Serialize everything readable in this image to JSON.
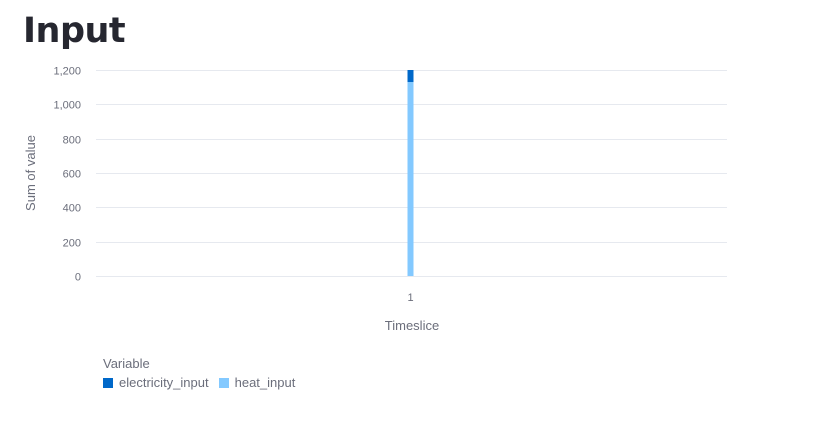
{
  "page": {
    "title": "Input"
  },
  "chart_data": {
    "type": "bar",
    "stacked": true,
    "categories": [
      "1"
    ],
    "series": [
      {
        "name": "electricity_input",
        "values": [
          70
        ],
        "color": "#0068c9"
      },
      {
        "name": "heat_input",
        "values": [
          1130
        ],
        "color": "#83c9ff"
      }
    ],
    "xlabel": "Timeslice",
    "ylabel": "Sum of value",
    "ylim": [
      0,
      1200
    ],
    "yticks": [
      0,
      200,
      400,
      600,
      800,
      1000,
      1200
    ],
    "ytick_labels": [
      "0",
      "200",
      "400",
      "600",
      "800",
      "1,000",
      "1,200"
    ],
    "grid": true,
    "legend": {
      "title": "Variable",
      "placement": "bottom-left"
    }
  }
}
